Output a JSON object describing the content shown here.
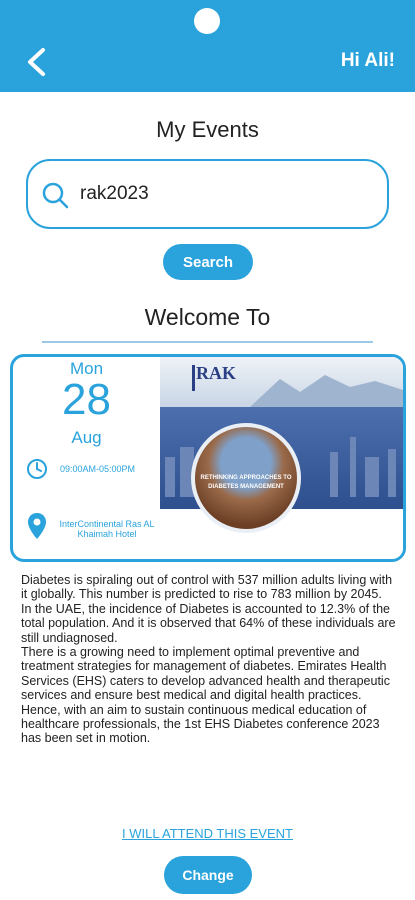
{
  "header": {
    "greeting": "Hi Ali!",
    "back_icon": "chevron-left-icon",
    "color": "#2aa3dc"
  },
  "page": {
    "title": "My Events"
  },
  "search": {
    "value": "rak2023",
    "button_label": "Search",
    "icon": "search-icon"
  },
  "welcome": {
    "text": "Welcome To"
  },
  "event": {
    "day_name": "Mon",
    "day_number": "28",
    "month": "Aug",
    "time": "09:00AM-05:00PM",
    "venue": "InterContinental Ras AL Khaimah Hotel",
    "image": {
      "logo_text": "RAK",
      "caption": "RETHINKING APPROACHES TO DIABETES MANAGEMENT"
    }
  },
  "description": [
    "Diabetes is spiraling out of control with 537 million adults living with it globally. This number is predicted to rise to 783 million by 2045.",
    "In the UAE, the incidence of Diabetes is accounted to 12.3% of the total population. And it is observed that 64% of these individuals are still undiagnosed.",
    "There is a growing need to implement optimal preventive and treatment strategies for management of diabetes. Emirates Health Services (EHS) caters to develop advanced health and therapeutic services and ensure best medical and digital health practices.",
    "Hence, with an aim to sustain continuous medical education of healthcare professionals, the 1st EHS Diabetes conference 2023 has been set in motion."
  ],
  "actions": {
    "attend_label": "I WILL ATTEND THIS EVENT",
    "change_label": "Change"
  }
}
